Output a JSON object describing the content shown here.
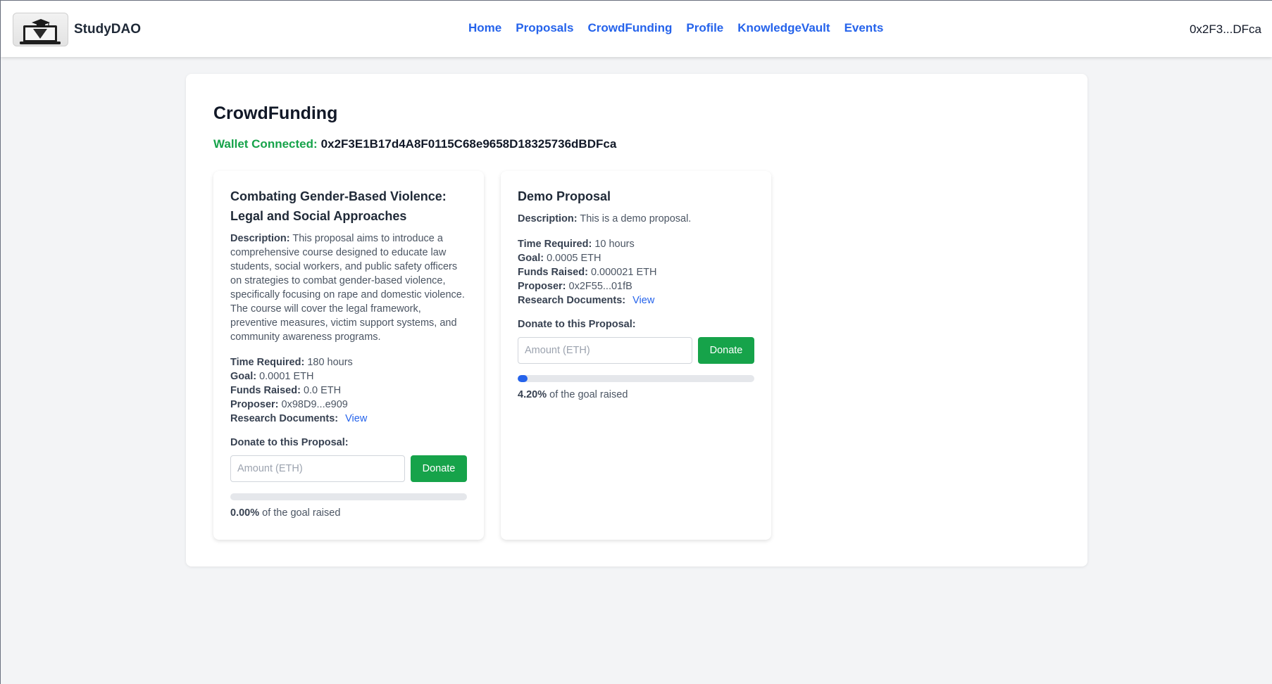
{
  "navbar": {
    "brand": "StudyDAO",
    "links": [
      "Home",
      "Proposals",
      "CrowdFunding",
      "Profile",
      "KnowledgeVault",
      "Events"
    ],
    "wallet_short": "0x2F3...DFca"
  },
  "page": {
    "title": "CrowdFunding",
    "wallet_label": "Wallet Connected:",
    "wallet_address": "0x2F3E1B17d4A8F0115C68e9658D18325736dBDFca"
  },
  "labels": {
    "description": "Description:",
    "time_required": "Time Required:",
    "goal": "Goal:",
    "funds_raised": "Funds Raised:",
    "proposer": "Proposer:",
    "research_documents": "Research Documents:",
    "view": "View",
    "donate_to": "Donate to this Proposal:",
    "amount_placeholder": "Amount (ETH)",
    "donate_button": "Donate",
    "goal_raised_suffix": "of the goal raised"
  },
  "proposals": [
    {
      "title": "Combating Gender-Based Violence: Legal and Social Approaches",
      "description": "This proposal aims to introduce a comprehensive course designed to educate law students, social workers, and public safety officers on strategies to combat gender-based violence, specifically focusing on rape and domestic violence. The course will cover the legal framework, preventive measures, victim support systems, and community awareness programs.",
      "time_required": "180 hours",
      "goal": "0.0001 ETH",
      "funds_raised": "0.0 ETH",
      "proposer": "0x98D9...e909",
      "progress_text": "0.00%",
      "progress_percent": 0
    },
    {
      "title": "Demo Proposal",
      "description": "This is a demo proposal.",
      "time_required": "10 hours",
      "goal": "0.0005 ETH",
      "funds_raised": "0.000021 ETH",
      "proposer": "0x2F55...01fB",
      "progress_text": "4.20%",
      "progress_percent": 4.2
    }
  ]
}
